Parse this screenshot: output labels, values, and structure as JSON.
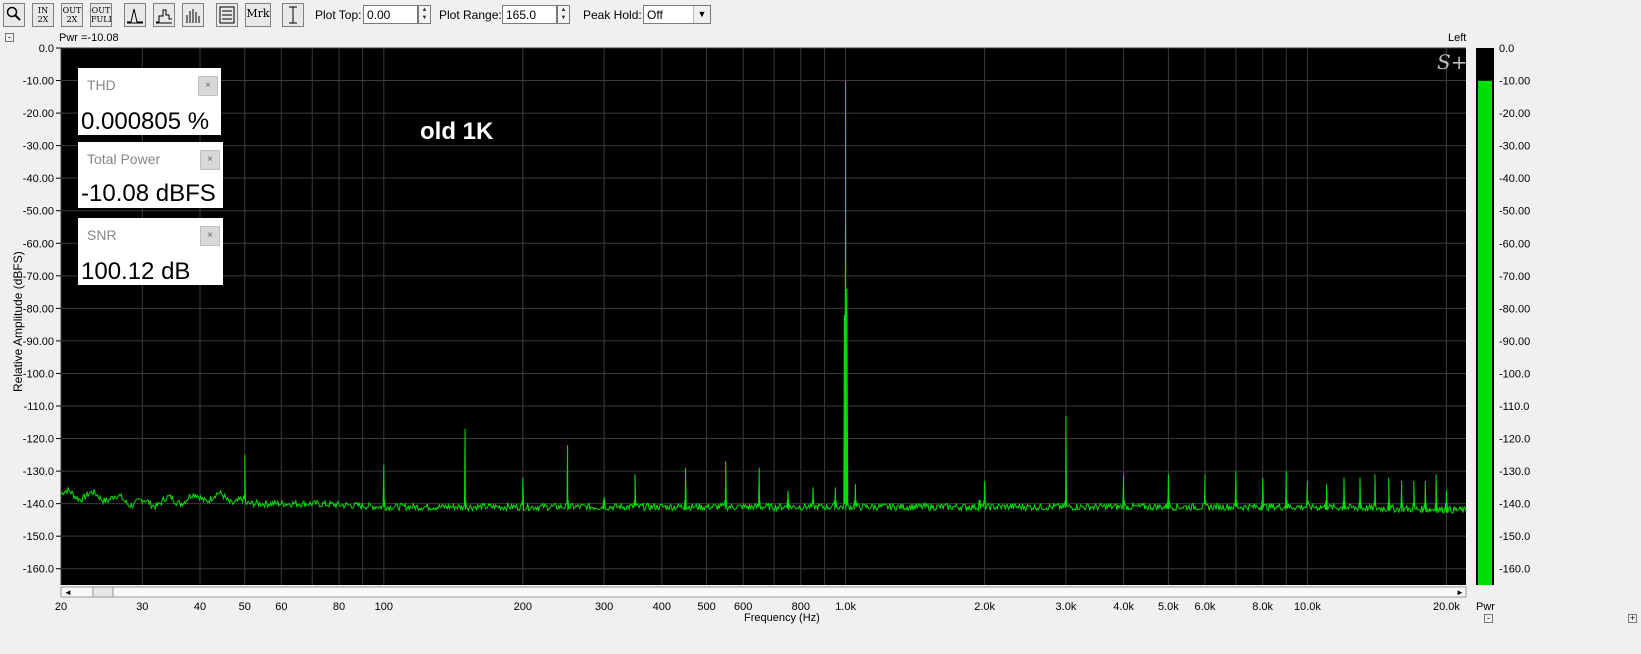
{
  "toolbar": {
    "buttons": [
      {
        "name": "zoom-button",
        "icon": "magnifier-icon"
      },
      {
        "name": "zoom-in-2x-button",
        "icon": "zoom-in-2x-icon",
        "l1": "IN",
        "l2": "2X"
      },
      {
        "name": "zoom-out-2x-button",
        "icon": "zoom-out-2x-icon",
        "l1": "OUT",
        "l2": "2X"
      },
      {
        "name": "zoom-out-full-button",
        "icon": "zoom-out-full-icon",
        "l1": "OUT",
        "l2": "FULL"
      },
      {
        "name": "line-plot-button",
        "icon": "line-plot-icon"
      },
      {
        "name": "step-plot-button",
        "icon": "step-plot-icon"
      },
      {
        "name": "bar-plot-button",
        "icon": "bar-plot-icon"
      },
      {
        "name": "settings-button",
        "icon": "list-icon"
      },
      {
        "name": "marker-button",
        "icon": "marker-icon",
        "l1": "Mrk"
      },
      {
        "name": "cursor-button",
        "icon": "vertical-cursor-icon"
      }
    ],
    "plot_top_label": "Plot Top:",
    "plot_top_value": "0.00",
    "plot_range_label": "Plot Range:",
    "plot_range_value": "165.0",
    "peak_hold_label": "Peak Hold:",
    "peak_hold_value": "Off"
  },
  "pwr_readout": "Pwr =-10.08",
  "channel": "Left",
  "logo": "S+",
  "annotation": "old 1K",
  "meter_label": "Pwr",
  "measurements": [
    {
      "title": "THD",
      "value": "0.000805 %"
    },
    {
      "title": "Total Power",
      "value": "-10.08 dBFS"
    },
    {
      "title": "SNR",
      "value": "100.12 dB"
    }
  ],
  "meter": {
    "level": -10.08,
    "min": -165,
    "max": 0,
    "color": "#00e000"
  },
  "chart_data": {
    "type": "line",
    "xlabel": "Frequency (Hz)",
    "ylabel": "Relative Amplitude (dBFS)",
    "xscale": "log",
    "xlim": [
      20,
      22050
    ],
    "ylim": [
      -165,
      0
    ],
    "grid": true,
    "yticks": [
      "0.0",
      "-10.00",
      "-20.00",
      "-30.00",
      "-40.00",
      "-50.00",
      "-60.00",
      "-70.00",
      "-80.00",
      "-90.00",
      "-100.0",
      "-110.0",
      "-120.0",
      "-130.0",
      "-140.0",
      "-150.0",
      "-160.0"
    ],
    "xtick_labels": [
      {
        "v": 20,
        "t": "20"
      },
      {
        "v": 30,
        "t": "30"
      },
      {
        "v": 40,
        "t": "40"
      },
      {
        "v": 50,
        "t": "50"
      },
      {
        "v": 60,
        "t": "60"
      },
      {
        "v": 80,
        "t": "80"
      },
      {
        "v": 100,
        "t": "100"
      },
      {
        "v": 200,
        "t": "200"
      },
      {
        "v": 300,
        "t": "300"
      },
      {
        "v": 400,
        "t": "400"
      },
      {
        "v": 500,
        "t": "500"
      },
      {
        "v": 600,
        "t": "600"
      },
      {
        "v": 800,
        "t": "800"
      },
      {
        "v": 1000,
        "t": "1.0k"
      },
      {
        "v": 2000,
        "t": "2.0k"
      },
      {
        "v": 3000,
        "t": "3.0k"
      },
      {
        "v": 4000,
        "t": "4.0k"
      },
      {
        "v": 5000,
        "t": "5.0k"
      },
      {
        "v": 6000,
        "t": "6.0k"
      },
      {
        "v": 8000,
        "t": "8.0k"
      },
      {
        "v": 10000,
        "t": "10.0k"
      },
      {
        "v": 20000,
        "t": "20.0k"
      }
    ],
    "series": [
      {
        "color": "#00e000",
        "noise_floor": [
          [
            20,
            -137
          ],
          [
            25,
            -138
          ],
          [
            30,
            -140
          ],
          [
            35,
            -139
          ],
          [
            40,
            -138
          ],
          [
            45,
            -138
          ],
          [
            50,
            -140
          ],
          [
            70,
            -140
          ],
          [
            100,
            -141
          ],
          [
            200,
            -141
          ],
          [
            1000,
            -141
          ],
          [
            5000,
            -141
          ],
          [
            10000,
            -141
          ],
          [
            22050,
            -142
          ]
        ],
        "peaks": [
          {
            "x": 50,
            "y": -125
          },
          {
            "x": 100,
            "y": -128
          },
          {
            "x": 150,
            "y": -117
          },
          {
            "x": 200,
            "y": -132
          },
          {
            "x": 250,
            "y": -122
          },
          {
            "x": 300,
            "y": -138
          },
          {
            "x": 350,
            "y": -131
          },
          {
            "x": 450,
            "y": -129
          },
          {
            "x": 550,
            "y": -127
          },
          {
            "x": 650,
            "y": -129
          },
          {
            "x": 750,
            "y": -136
          },
          {
            "x": 850,
            "y": -135
          },
          {
            "x": 950,
            "y": -135
          },
          {
            "x": 1000,
            "y": -10.08
          },
          {
            "x": 1050,
            "y": -134
          },
          {
            "x": 1950,
            "y": -139
          },
          {
            "x": 2000,
            "y": -133
          },
          {
            "x": 3000,
            "y": -113
          },
          {
            "x": 4000,
            "y": -131
          },
          {
            "x": 5000,
            "y": -131
          },
          {
            "x": 6000,
            "y": -131
          },
          {
            "x": 7000,
            "y": -130
          },
          {
            "x": 8000,
            "y": -132
          },
          {
            "x": 9000,
            "y": -130
          },
          {
            "x": 10000,
            "y": -133
          },
          {
            "x": 11000,
            "y": -134
          },
          {
            "x": 12000,
            "y": -132
          },
          {
            "x": 13000,
            "y": -132
          },
          {
            "x": 14000,
            "y": -131
          },
          {
            "x": 15000,
            "y": -132
          },
          {
            "x": 16000,
            "y": -133
          },
          {
            "x": 17000,
            "y": -133
          },
          {
            "x": 18000,
            "y": -133
          },
          {
            "x": 19000,
            "y": -131
          },
          {
            "x": 20000,
            "y": -136
          }
        ]
      }
    ]
  }
}
